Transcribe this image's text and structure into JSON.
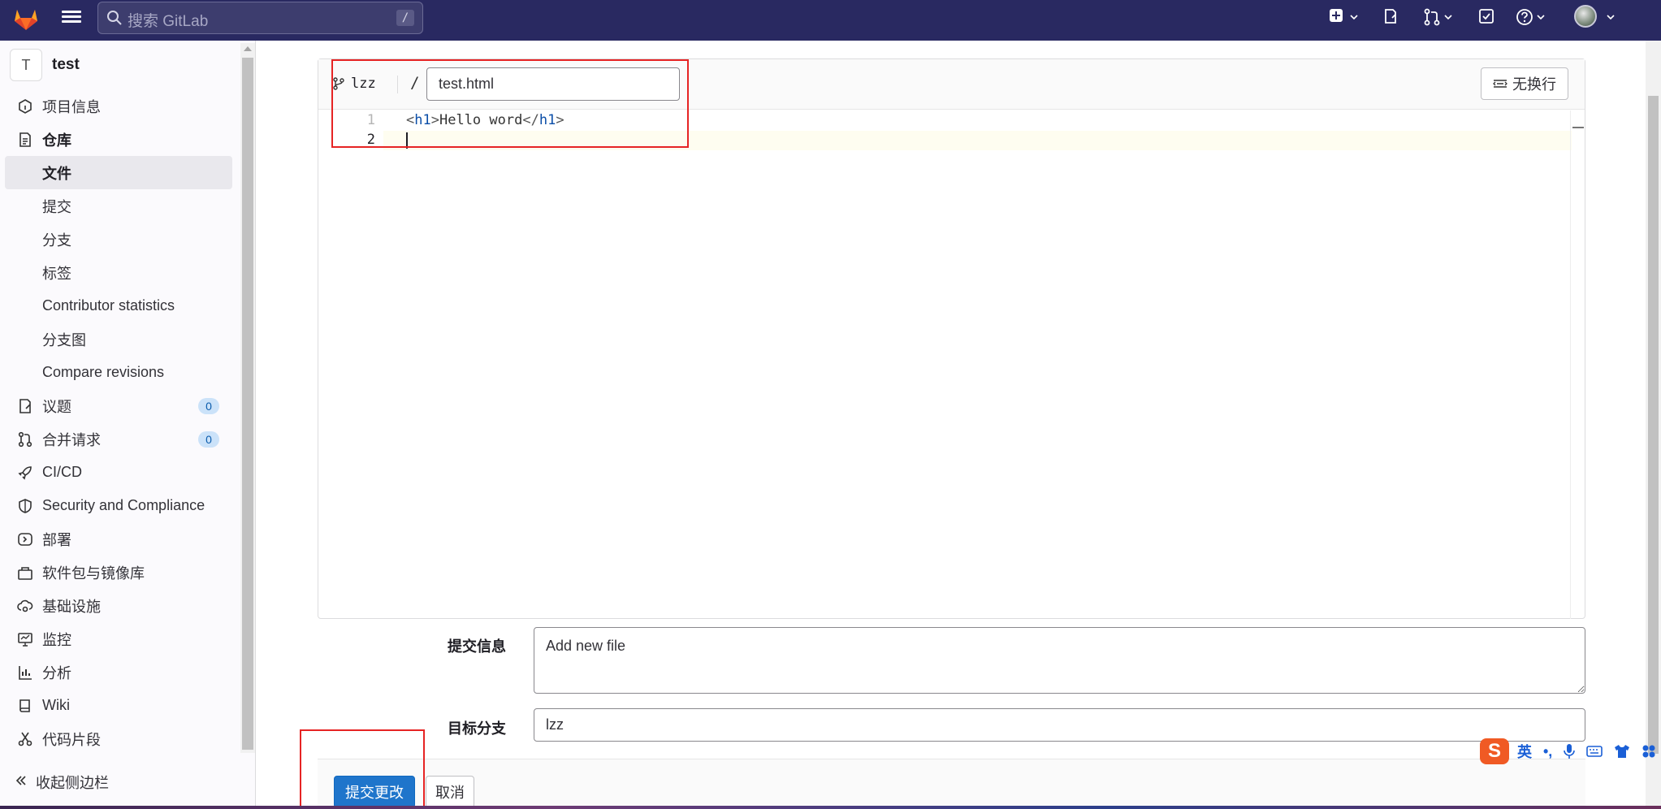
{
  "topnav": {
    "search_placeholder": "搜索 GitLab",
    "search_shortcut": "/"
  },
  "sidebar": {
    "project_initial": "T",
    "project_name": "test",
    "items": [
      {
        "label": "项目信息",
        "icon": "info-icon"
      },
      {
        "label": "仓库",
        "icon": "repository-icon"
      },
      {
        "label": "文件",
        "icon": ""
      },
      {
        "label": "提交",
        "icon": ""
      },
      {
        "label": "分支",
        "icon": ""
      },
      {
        "label": "标签",
        "icon": ""
      },
      {
        "label": "Contributor statistics",
        "icon": ""
      },
      {
        "label": "分支图",
        "icon": ""
      },
      {
        "label": "Compare revisions",
        "icon": ""
      },
      {
        "label": "议题",
        "icon": "issues-icon",
        "badge": "0"
      },
      {
        "label": "合并请求",
        "icon": "merge-request-icon",
        "badge": "0"
      },
      {
        "label": "CI/CD",
        "icon": "rocket-icon"
      },
      {
        "label": "Security and Compliance",
        "icon": "shield-icon"
      },
      {
        "label": "部署",
        "icon": "deploy-icon"
      },
      {
        "label": "软件包与镜像库",
        "icon": "package-icon"
      },
      {
        "label": "基础设施",
        "icon": "cloud-gear-icon"
      },
      {
        "label": "监控",
        "icon": "monitor-icon"
      },
      {
        "label": "分析",
        "icon": "chart-icon"
      },
      {
        "label": "Wiki",
        "icon": "book-icon"
      },
      {
        "label": "代码片段",
        "icon": "snippet-icon"
      }
    ],
    "collapse_label": "收起侧边栏"
  },
  "editor": {
    "branch": "lzz",
    "path_separator": "/",
    "file_name": "test.html",
    "wrap_button": "无换行",
    "line_numbers": [
      "1",
      "2"
    ],
    "line1": {
      "open_lt": "<",
      "open_tag": "h1",
      "open_gt": ">",
      "text": "Hello word",
      "close_lt": "</",
      "close_tag": "h1",
      "close_gt": ">"
    }
  },
  "form": {
    "commit_label": "提交信息",
    "commit_message": "Add new file",
    "target_label": "目标分支",
    "target_branch": "lzz",
    "submit_button": "提交更改",
    "cancel_button": "取消"
  },
  "ime": {
    "logo": "S",
    "lang": "英",
    "punct": "•,"
  },
  "colors": {
    "nav_bg": "#292961",
    "primary": "#1f75cb",
    "highlight_box": "#e62424"
  }
}
